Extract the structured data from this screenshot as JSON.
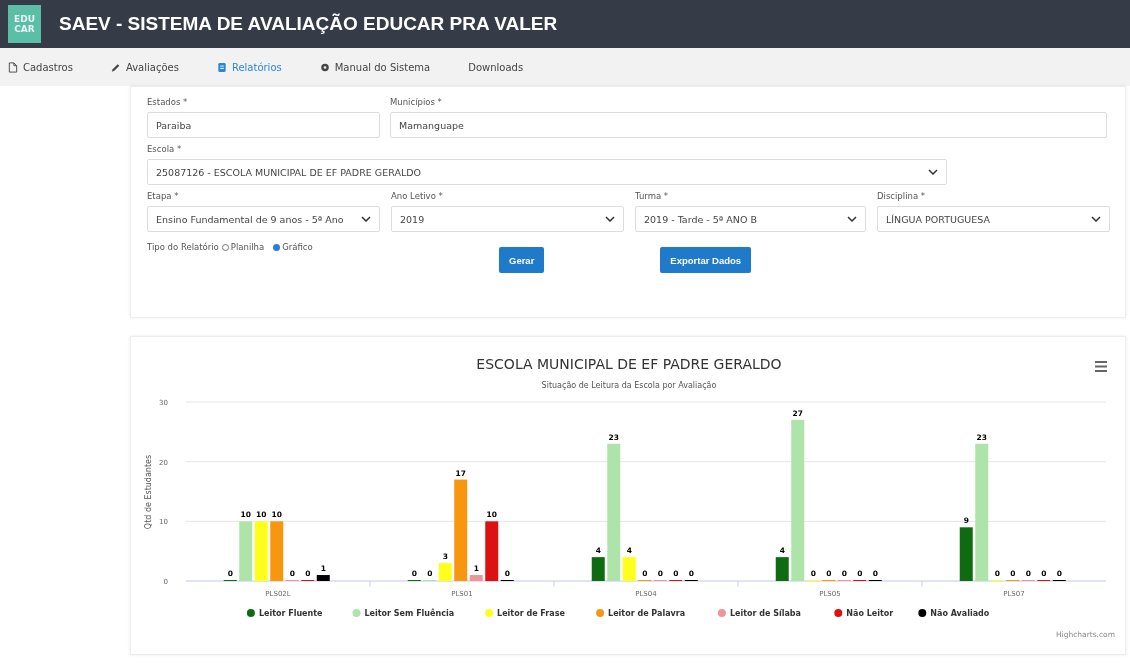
{
  "header": {
    "logo": [
      "EDU",
      "CAR"
    ],
    "title": "SAEV - SISTEMA DE AVALIAÇÃO EDUCAR PRA VALER"
  },
  "nav": [
    {
      "label": "Cadastros",
      "selected": false
    },
    {
      "label": "Avaliações",
      "selected": false
    },
    {
      "label": "Relatórios",
      "selected": true
    },
    {
      "label": "Manual do Sistema",
      "selected": false
    },
    {
      "label": "Downloads",
      "selected": false
    }
  ],
  "form": {
    "estados": {
      "label": "Estados *",
      "value": "Paraiba"
    },
    "municipios": {
      "label": "Municípios *",
      "value": "Mamanguape"
    },
    "escola": {
      "label": "Escola *",
      "value": "25087126 - ESCOLA MUNICIPAL DE EF PADRE GERALDO"
    },
    "selects": [
      {
        "label": "Etapa *",
        "value": "Ensino Fundamental de 9 anos - 5ª Ano"
      },
      {
        "label": "Ano Letivo *",
        "value": "2019"
      },
      {
        "label": "Turma *",
        "value": "2019 - Tarde - 5ª ANO B"
      },
      {
        "label": "Disciplina *",
        "value": "LÍNGUA PORTUGUESA"
      }
    ],
    "report_type": {
      "label": "Tipo do Relatório",
      "options": [
        {
          "label": "Planilha",
          "selected": false
        },
        {
          "label": "Gráfico",
          "selected": true
        }
      ]
    },
    "buttons": [
      "Gerar",
      "Exportar Dados"
    ]
  },
  "chart_card": {
    "credits": "Highcharts.com",
    "chart_data": {
      "type": "bar",
      "title": "ESCOLA MUNICIPAL DE EF PADRE GERALDO",
      "subtitle": "Situação de Leitura da Escola por Avaliação",
      "ylabel": "Qtd de Estudantes",
      "categories": [
        "PLS02L",
        "PLS01",
        "PLS04",
        "PLS05",
        "PLS07"
      ],
      "ylim": [
        0,
        30
      ],
      "yticks": [
        0,
        10,
        20,
        30
      ],
      "data_labels": true,
      "legend": "bottom",
      "series": [
        {
          "name": "Leitor Fluente",
          "color": "#0f6b12",
          "values": [
            0,
            0,
            4,
            4,
            9
          ]
        },
        {
          "name": "Leitor Sem Fluência",
          "color": "#aee3a9",
          "values": [
            10,
            0,
            23,
            27,
            23
          ]
        },
        {
          "name": "Leitor de Frase",
          "color": "#ffff1c",
          "values": [
            10,
            3,
            4,
            0,
            0
          ]
        },
        {
          "name": "Leitor de Palavra",
          "color": "#f7960f",
          "values": [
            10,
            17,
            0,
            0,
            0
          ]
        },
        {
          "name": "Leitor de Sílaba",
          "color": "#ee9598",
          "values": [
            0,
            1,
            0,
            0,
            0
          ]
        },
        {
          "name": "Não Leitor",
          "color": "#dd1111",
          "values": [
            0,
            10,
            0,
            0,
            0
          ]
        },
        {
          "name": "Não Avaliado",
          "color": "#000000",
          "values": [
            1,
            0,
            0,
            0,
            0
          ]
        }
      ]
    }
  }
}
